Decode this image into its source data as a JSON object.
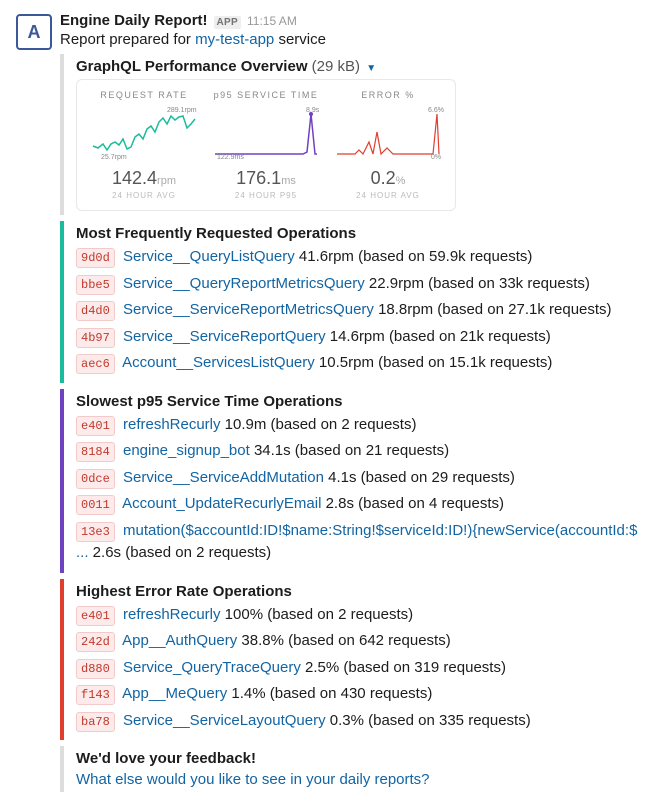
{
  "sender": "Engine Daily Report!",
  "app_badge": "APP",
  "time": "11:15 AM",
  "subtitle_prefix": "Report prepared for ",
  "subtitle_service": "my-test-app",
  "subtitle_suffix": " service",
  "overview": {
    "title": "GraphQL Performance Overview",
    "size": "(29 kB)",
    "charts": [
      {
        "title": "REQUEST RATE",
        "big": "142.4",
        "unit": "rpm",
        "sub": "24 HOUR AVG",
        "lo": "25.7rpm",
        "hi": "289.1rpm",
        "color": "#1abc9c"
      },
      {
        "title": "p95 SERVICE TIME",
        "big": "176.1",
        "unit": "ms",
        "sub": "24 HOUR P95",
        "lo": "122.9ms",
        "hi": "8.9s",
        "color": "#6f42c1"
      },
      {
        "title": "ERROR %",
        "big": "0.2",
        "unit": "%",
        "sub": "24 HOUR AVG",
        "lo": "0%",
        "hi": "6.6%",
        "color": "#e03e2f"
      }
    ]
  },
  "sections": [
    {
      "bar": "teal",
      "title": "Most Frequently Requested Operations",
      "rows": [
        {
          "hash": "9d0d",
          "name": "Service__QueryListQuery",
          "meta": "41.6rpm (based on 59.9k requests)"
        },
        {
          "hash": "bbe5",
          "name": "Service__QueryReportMetricsQuery",
          "meta": "22.9rpm (based on 33k requests)"
        },
        {
          "hash": "d4d0",
          "name": "Service__ServiceReportMetricsQuery",
          "meta": "18.8rpm (based on 27.1k requests)"
        },
        {
          "hash": "4b97",
          "name": "Service__ServiceReportQuery",
          "meta": "14.6rpm (based on 21k requests)"
        },
        {
          "hash": "aec6",
          "name": "Account__ServicesListQuery",
          "meta": "10.5rpm (based on 15.1k requests)"
        }
      ]
    },
    {
      "bar": "purple",
      "title": "Slowest p95 Service Time Operations",
      "rows": [
        {
          "hash": "e401",
          "name": "refreshRecurly",
          "meta": "10.9m (based on 2 requests)"
        },
        {
          "hash": "8184",
          "name": "engine_signup_bot",
          "meta": "34.1s (based on 21 requests)"
        },
        {
          "hash": "0dce",
          "name": "Service__ServiceAddMutation",
          "meta": "4.1s (based on 29 requests)"
        },
        {
          "hash": "0011",
          "name": "Account_UpdateRecurlyEmail",
          "meta": "2.8s (based on 4 requests)"
        },
        {
          "hash": "13e3",
          "name": "mutation($accountId:ID!$name:String!$serviceId:ID!){newService(accountId:$ ...",
          "meta": "2.6s (based on 2 requests)"
        }
      ]
    },
    {
      "bar": "red",
      "title": "Highest Error Rate Operations",
      "rows": [
        {
          "hash": "e401",
          "name": "refreshRecurly",
          "meta": "100% (based on 2 requests)"
        },
        {
          "hash": "242d",
          "name": "App__AuthQuery",
          "meta": "38.8% (based on 642 requests)"
        },
        {
          "hash": "d880",
          "name": "Service_QueryTraceQuery",
          "meta": "2.5% (based on 319 requests)"
        },
        {
          "hash": "f143",
          "name": "App__MeQuery",
          "meta": "1.4% (based on 430 requests)"
        },
        {
          "hash": "ba78",
          "name": "Service__ServiceLayoutQuery",
          "meta": "0.3% (based on 335 requests)"
        }
      ]
    }
  ],
  "feedback": {
    "title": "We'd love your feedback!",
    "link": "What else would you like to see in your daily reports?"
  },
  "chart_data": [
    {
      "type": "line",
      "title": "REQUEST RATE",
      "ylabel": "rpm",
      "ylim": [
        25.7,
        289.1
      ],
      "summary": 142.4,
      "summary_label": "24 HOUR AVG"
    },
    {
      "type": "line",
      "title": "p95 SERVICE TIME",
      "ylabel": "ms",
      "ylim": [
        122.9,
        8900
      ],
      "summary": 176.1,
      "summary_label": "24 HOUR P95"
    },
    {
      "type": "line",
      "title": "ERROR %",
      "ylabel": "%",
      "ylim": [
        0,
        6.6
      ],
      "summary": 0.2,
      "summary_label": "24 HOUR AVG"
    }
  ]
}
